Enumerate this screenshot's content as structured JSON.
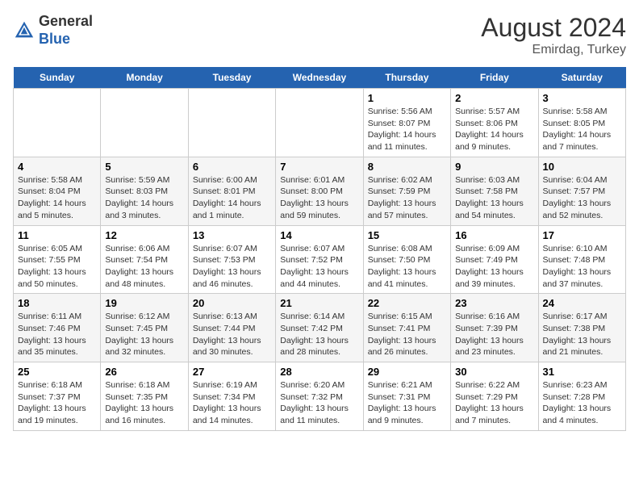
{
  "header": {
    "logo_general": "General",
    "logo_blue": "Blue",
    "month_year": "August 2024",
    "location": "Emirdag, Turkey"
  },
  "days": [
    "Sunday",
    "Monday",
    "Tuesday",
    "Wednesday",
    "Thursday",
    "Friday",
    "Saturday"
  ],
  "weeks": [
    [
      {
        "date": "",
        "info": ""
      },
      {
        "date": "",
        "info": ""
      },
      {
        "date": "",
        "info": ""
      },
      {
        "date": "",
        "info": ""
      },
      {
        "date": "1",
        "info": "Sunrise: 5:56 AM\nSunset: 8:07 PM\nDaylight: 14 hours and 11 minutes."
      },
      {
        "date": "2",
        "info": "Sunrise: 5:57 AM\nSunset: 8:06 PM\nDaylight: 14 hours and 9 minutes."
      },
      {
        "date": "3",
        "info": "Sunrise: 5:58 AM\nSunset: 8:05 PM\nDaylight: 14 hours and 7 minutes."
      }
    ],
    [
      {
        "date": "4",
        "info": "Sunrise: 5:58 AM\nSunset: 8:04 PM\nDaylight: 14 hours and 5 minutes."
      },
      {
        "date": "5",
        "info": "Sunrise: 5:59 AM\nSunset: 8:03 PM\nDaylight: 14 hours and 3 minutes."
      },
      {
        "date": "6",
        "info": "Sunrise: 6:00 AM\nSunset: 8:01 PM\nDaylight: 14 hours and 1 minute."
      },
      {
        "date": "7",
        "info": "Sunrise: 6:01 AM\nSunset: 8:00 PM\nDaylight: 13 hours and 59 minutes."
      },
      {
        "date": "8",
        "info": "Sunrise: 6:02 AM\nSunset: 7:59 PM\nDaylight: 13 hours and 57 minutes."
      },
      {
        "date": "9",
        "info": "Sunrise: 6:03 AM\nSunset: 7:58 PM\nDaylight: 13 hours and 54 minutes."
      },
      {
        "date": "10",
        "info": "Sunrise: 6:04 AM\nSunset: 7:57 PM\nDaylight: 13 hours and 52 minutes."
      }
    ],
    [
      {
        "date": "11",
        "info": "Sunrise: 6:05 AM\nSunset: 7:55 PM\nDaylight: 13 hours and 50 minutes."
      },
      {
        "date": "12",
        "info": "Sunrise: 6:06 AM\nSunset: 7:54 PM\nDaylight: 13 hours and 48 minutes."
      },
      {
        "date": "13",
        "info": "Sunrise: 6:07 AM\nSunset: 7:53 PM\nDaylight: 13 hours and 46 minutes."
      },
      {
        "date": "14",
        "info": "Sunrise: 6:07 AM\nSunset: 7:52 PM\nDaylight: 13 hours and 44 minutes."
      },
      {
        "date": "15",
        "info": "Sunrise: 6:08 AM\nSunset: 7:50 PM\nDaylight: 13 hours and 41 minutes."
      },
      {
        "date": "16",
        "info": "Sunrise: 6:09 AM\nSunset: 7:49 PM\nDaylight: 13 hours and 39 minutes."
      },
      {
        "date": "17",
        "info": "Sunrise: 6:10 AM\nSunset: 7:48 PM\nDaylight: 13 hours and 37 minutes."
      }
    ],
    [
      {
        "date": "18",
        "info": "Sunrise: 6:11 AM\nSunset: 7:46 PM\nDaylight: 13 hours and 35 minutes."
      },
      {
        "date": "19",
        "info": "Sunrise: 6:12 AM\nSunset: 7:45 PM\nDaylight: 13 hours and 32 minutes."
      },
      {
        "date": "20",
        "info": "Sunrise: 6:13 AM\nSunset: 7:44 PM\nDaylight: 13 hours and 30 minutes."
      },
      {
        "date": "21",
        "info": "Sunrise: 6:14 AM\nSunset: 7:42 PM\nDaylight: 13 hours and 28 minutes."
      },
      {
        "date": "22",
        "info": "Sunrise: 6:15 AM\nSunset: 7:41 PM\nDaylight: 13 hours and 26 minutes."
      },
      {
        "date": "23",
        "info": "Sunrise: 6:16 AM\nSunset: 7:39 PM\nDaylight: 13 hours and 23 minutes."
      },
      {
        "date": "24",
        "info": "Sunrise: 6:17 AM\nSunset: 7:38 PM\nDaylight: 13 hours and 21 minutes."
      }
    ],
    [
      {
        "date": "25",
        "info": "Sunrise: 6:18 AM\nSunset: 7:37 PM\nDaylight: 13 hours and 19 minutes."
      },
      {
        "date": "26",
        "info": "Sunrise: 6:18 AM\nSunset: 7:35 PM\nDaylight: 13 hours and 16 minutes."
      },
      {
        "date": "27",
        "info": "Sunrise: 6:19 AM\nSunset: 7:34 PM\nDaylight: 13 hours and 14 minutes."
      },
      {
        "date": "28",
        "info": "Sunrise: 6:20 AM\nSunset: 7:32 PM\nDaylight: 13 hours and 11 minutes."
      },
      {
        "date": "29",
        "info": "Sunrise: 6:21 AM\nSunset: 7:31 PM\nDaylight: 13 hours and 9 minutes."
      },
      {
        "date": "30",
        "info": "Sunrise: 6:22 AM\nSunset: 7:29 PM\nDaylight: 13 hours and 7 minutes."
      },
      {
        "date": "31",
        "info": "Sunrise: 6:23 AM\nSunset: 7:28 PM\nDaylight: 13 hours and 4 minutes."
      }
    ]
  ]
}
